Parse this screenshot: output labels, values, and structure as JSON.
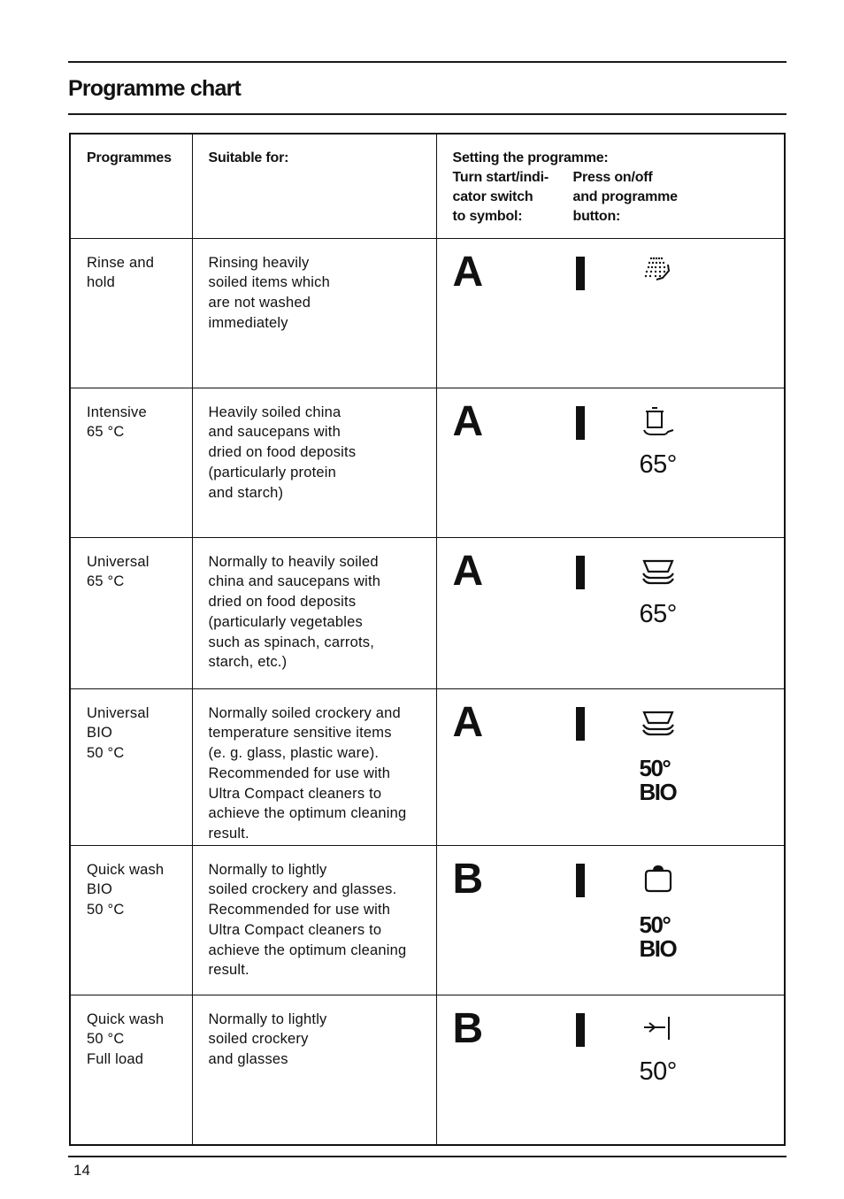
{
  "page": {
    "title": "Programme chart",
    "page_number": "14"
  },
  "table": {
    "headers": {
      "programmes": "Programmes",
      "suitable_for": "Suitable for:",
      "setting_title": "Setting the programme:",
      "switch_label": [
        "Turn start/indi-",
        "cator switch",
        "to symbol:"
      ],
      "button_label": [
        "Press on/off",
        "and programme",
        "button:"
      ]
    },
    "rows": [
      {
        "programme": [
          "Rinse and",
          "hold"
        ],
        "suitable": [
          "Rinsing heavily",
          "soiled items which",
          "are not washed",
          "immediately"
        ],
        "switch_symbol": "A",
        "button_symbol": "I",
        "icon": "rinse-spray-icon",
        "temp": [],
        "temp_bold": false
      },
      {
        "programme": [
          "Intensive",
          "65 °C"
        ],
        "suitable": [
          "Heavily soiled china",
          "and saucepans with",
          "dried on food deposits",
          "(particularly protein",
          "and starch)"
        ],
        "switch_symbol": "A",
        "button_symbol": "I",
        "icon": "pot-and-pan-icon",
        "temp": [
          "65°"
        ],
        "temp_bold": false
      },
      {
        "programme": [
          "Universal",
          "65 °C"
        ],
        "suitable": [
          "Normally to heavily soiled",
          "china and saucepans with",
          "dried on food deposits",
          "(particularly vegetables",
          "such as spinach, carrots,",
          "starch, etc.)"
        ],
        "switch_symbol": "A",
        "button_symbol": "I",
        "icon": "stacked-dishes-icon",
        "temp": [
          "65°"
        ],
        "temp_bold": false
      },
      {
        "programme": [
          "Universal BIO",
          "50 °C"
        ],
        "suitable": [
          "Normally soiled crockery and",
          "temperature sensitive items",
          "(e. g. glass, plastic ware).",
          "Recommended for use with",
          "Ultra Compact cleaners to",
          "achieve the optimum cleaning",
          "result."
        ],
        "switch_symbol": "A",
        "button_symbol": "I",
        "icon": "stacked-dishes-icon",
        "temp": [
          "50°",
          "BIO"
        ],
        "temp_bold": true
      },
      {
        "programme": [
          "Quick wash",
          "BIO",
          "50 °C"
        ],
        "suitable": [
          "Normally to lightly",
          "soiled crockery and glasses.",
          "Recommended for use with",
          "Ultra Compact cleaners to",
          "achieve the optimum cleaning",
          "result."
        ],
        "switch_symbol": "B",
        "button_symbol": "I",
        "icon": "quick-wash-bowl-icon",
        "temp": [
          "50°",
          "BIO"
        ],
        "temp_bold": true
      },
      {
        "programme": [
          "Quick wash",
          "50 °C",
          "Full load"
        ],
        "suitable": [
          "Normally to lightly",
          "soiled crockery",
          "and glasses"
        ],
        "switch_symbol": "B",
        "button_symbol": "I",
        "icon": "arrow-to-bar-icon",
        "temp": [
          "50°"
        ],
        "temp_bold": false
      }
    ]
  }
}
